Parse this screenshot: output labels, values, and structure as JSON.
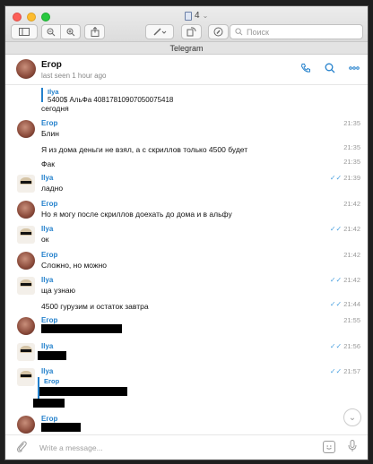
{
  "window": {
    "tab_count": "4",
    "search_placeholder": "Поиск",
    "tab_title": "Telegram"
  },
  "chat_header": {
    "name": "Егор",
    "status": "last seen 1 hour ago"
  },
  "messages": [
    {
      "type": "quote_tail",
      "quote_name": "Ilya",
      "quote_text": "5400$ АльФа 40817810907050075418",
      "text": "сегодня",
      "time": ""
    },
    {
      "type": "head",
      "sender": "Егор",
      "text": "Блин",
      "time": "21:35",
      "read": false
    },
    {
      "type": "cont",
      "text": "Я из дома деньги не взял, а с скриллов только 4500 будет",
      "time": "21:35",
      "read": false
    },
    {
      "type": "cont",
      "text": "Фак",
      "time": "21:35",
      "read": false
    },
    {
      "type": "head",
      "sender": "Ilya",
      "text": "ладно",
      "time": "21:39",
      "read": true
    },
    {
      "type": "head",
      "sender": "Егор",
      "text": "Но я могу  после скриллов доехать до дома и в альфу",
      "time": "21:42",
      "read": false
    },
    {
      "type": "head",
      "sender": "Ilya",
      "text": "ок",
      "time": "21:42",
      "read": true
    },
    {
      "type": "head",
      "sender": "Егор",
      "text": "Сложно, но можно",
      "time": "21:42",
      "read": false
    },
    {
      "type": "head",
      "sender": "Ilya",
      "text": "ща узнаю",
      "time": "21:42",
      "read": true
    },
    {
      "type": "cont",
      "text": "4500 гурузим и остаток завтра",
      "time": "21:44",
      "read": true
    },
    {
      "type": "head",
      "sender": "Егор",
      "text": "",
      "time": "21:55",
      "read": false
    },
    {
      "type": "head",
      "sender": "Ilya",
      "text": "",
      "time": "21:56",
      "read": true
    },
    {
      "type": "head",
      "sender": "Ilya",
      "text": "",
      "quote_name": "Егор",
      "time": "21:57",
      "read": true
    },
    {
      "type": "head",
      "sender": "Егор",
      "text": "",
      "time": "",
      "read": false
    }
  ],
  "composer": {
    "placeholder": "Write a message..."
  },
  "icons": {
    "attach": "paperclip-icon",
    "emoji": "emoji-icon",
    "mic": "microphone-icon",
    "call": "phone-icon",
    "search": "search-icon",
    "more": "more-icon"
  },
  "colors": {
    "accent": "#2481cc",
    "read_tick": "#4fa3e0"
  }
}
